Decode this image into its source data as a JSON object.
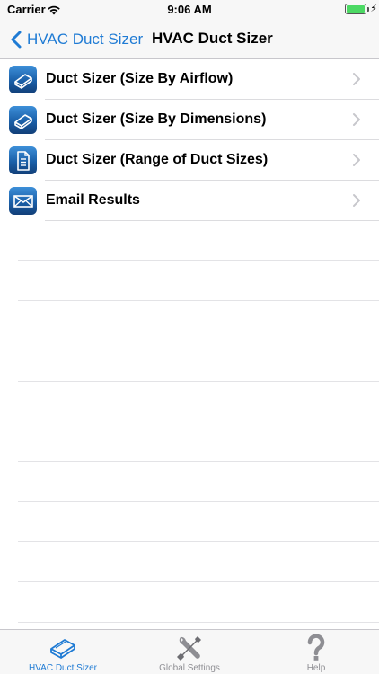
{
  "status_bar": {
    "carrier": "Carrier",
    "time": "9:06 AM",
    "battery_level": 1.0,
    "battery_color": "#4cd964"
  },
  "nav": {
    "back_label": "HVAC Duct Sizer",
    "title": "HVAC Duct Sizer",
    "accent_color": "#1f7bd4"
  },
  "menu": {
    "items": [
      {
        "label": "Duct Sizer (Size By Airflow)",
        "icon": "duct-icon"
      },
      {
        "label": "Duct Sizer (Size By Dimensions)",
        "icon": "duct-icon"
      },
      {
        "label": "Duct Sizer (Range of Duct Sizes)",
        "icon": "document-icon"
      },
      {
        "label": "Email Results",
        "icon": "envelope-icon"
      }
    ]
  },
  "tab_bar": {
    "tabs": [
      {
        "label": "HVAC Duct Sizer",
        "icon": "duct-icon",
        "active": true
      },
      {
        "label": "Global Settings",
        "icon": "tools-icon",
        "active": false
      },
      {
        "label": "Help",
        "icon": "question-mark-icon",
        "active": false
      }
    ]
  }
}
